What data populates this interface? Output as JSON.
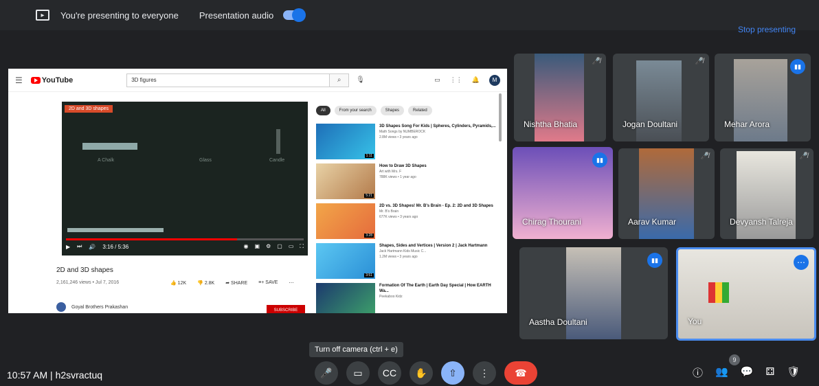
{
  "topbar": {
    "presenting_text": "You're presenting to everyone",
    "audio_label": "Presentation audio",
    "stop_label": "Stop presenting"
  },
  "youtube": {
    "logo": "YouTube",
    "search_value": "3D figures",
    "video_tag": "2D and 3D shapes",
    "labels": [
      "A Chalk",
      "Glass",
      "Candle"
    ],
    "time": "3:16 / 5:36",
    "progress": 0.72,
    "title": "2D and 3D shapes",
    "meta": "2,161,246 views • Jul 7, 2016",
    "likes": "12K",
    "dislikes": "2.8K",
    "share": "SHARE",
    "save": "SAVE",
    "channel": "Goyal Brothers Prakashan",
    "subscribe": "SUBSCRIBE",
    "chips": [
      "All",
      "From your search",
      "Shapes",
      "Related"
    ],
    "recs": [
      {
        "title": "3D Shapes Song For Kids | Spheres, Cylinders, Pyramids,...",
        "channel": "Math Songs by NUMBEROCK",
        "stats": "2.8M views • 3 years ago",
        "dur": "1:11"
      },
      {
        "title": "How to Draw 3D Shapes",
        "channel": "Art with Mrs. F",
        "stats": "788K views • 1 year ago",
        "dur": "5:21"
      },
      {
        "title": "2D vs. 3D Shapes! Mr. B's Brain - Ep. 2: 2D and 3D Shapes",
        "channel": "Mr. B's Brain",
        "stats": "677K views • 3 years ago",
        "dur": "3:28"
      },
      {
        "title": "Shapes, Sides and Vertices | Version 2 | Jack Hartmann",
        "channel": "Jack Hartmann Kids Music C...",
        "stats": "1.2M views • 3 years ago",
        "dur": "3:51"
      },
      {
        "title": "Formation Of The Earth | Earth Day Special | How EARTH Wa...",
        "channel": "Peekaboo Kidz",
        "stats": "",
        "dur": ""
      }
    ]
  },
  "participants": [
    {
      "name": "Nishtha Bhatia"
    },
    {
      "name": "Jogan Doultani"
    },
    {
      "name": "Mehar Arora"
    },
    {
      "name": "Chirag Thourani"
    },
    {
      "name": "Aarav Kumar"
    },
    {
      "name": "Devyansh Talreja"
    },
    {
      "name": "Aastha Doultani"
    },
    {
      "name": "You"
    }
  ],
  "bottom": {
    "tooltip": "Turn off camera (ctrl + e)",
    "clock": "10:57 AM  |  h2svractuq",
    "people_count": "9"
  }
}
